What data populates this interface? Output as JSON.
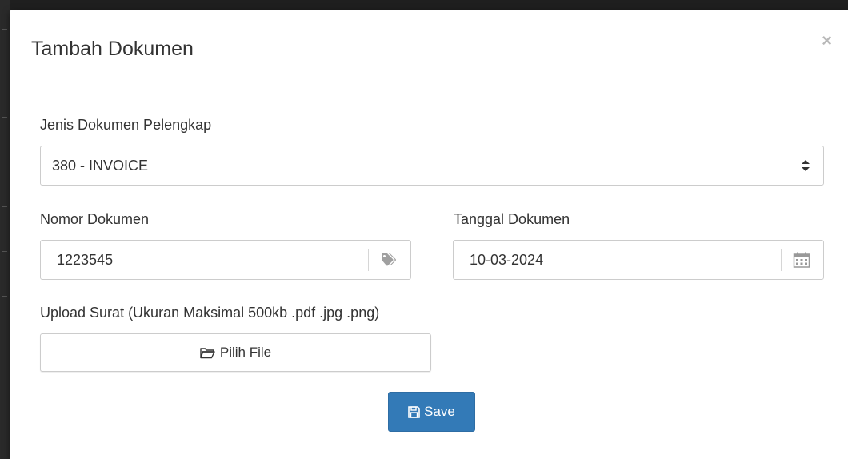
{
  "modal": {
    "title": "Tambah Dokumen",
    "close_label": "×"
  },
  "form": {
    "jenis": {
      "label": "Jenis Dokumen Pelengkap",
      "selected": "380 - INVOICE"
    },
    "nomor": {
      "label": "Nomor Dokumen",
      "value": "1223545",
      "icon": "tag-icon"
    },
    "tanggal": {
      "label": "Tanggal Dokumen",
      "value": "10-03-2024",
      "icon": "calendar-icon"
    },
    "upload": {
      "label": "Upload Surat (Ukuran Maksimal 500kb .pdf .jpg .png)",
      "button_label": "Pilih File",
      "icon": "folder-open-icon"
    },
    "save": {
      "label": "Save",
      "icon": "floppy-disk-icon"
    }
  },
  "colors": {
    "primary": "#337ab7",
    "border": "#cccccc",
    "text": "#333333"
  }
}
